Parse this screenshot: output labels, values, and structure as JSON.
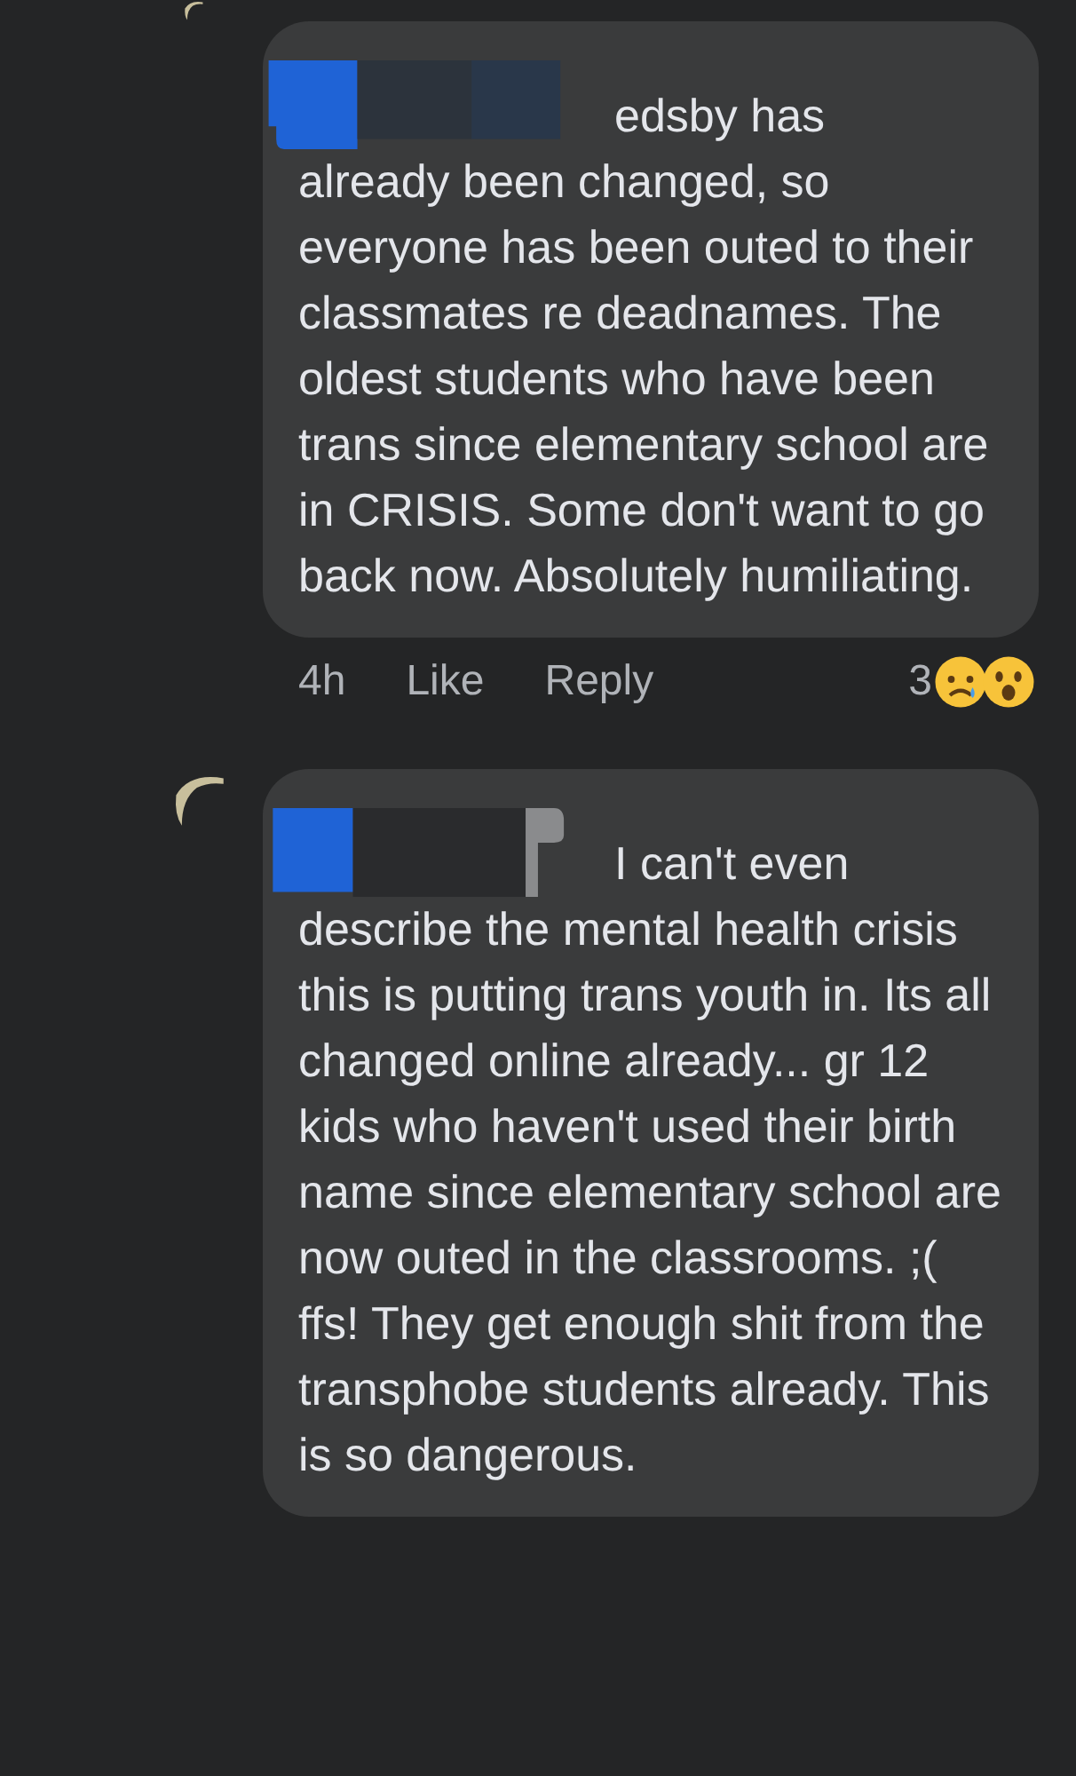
{
  "comments": [
    {
      "lead": "edsby has",
      "text": "already been changed, so everyone has been outed to their classmates re deadnames. The oldest students who have been trans since elementary school are in CRISIS. Some don't want to go back now. Absolutely humiliating.",
      "time": "4h",
      "actions": [
        "Like",
        "Reply"
      ],
      "reaction_count": "3"
    },
    {
      "lead": "I can't even",
      "text": "describe the mental health crisis this is putting trans youth in. Its all changed online already... gr 12 kids who haven't used their birth name since elementary school are now outed in the classrooms. ;( ffs! They get enough shit from the transphobe students already. This is so dangerous."
    }
  ]
}
